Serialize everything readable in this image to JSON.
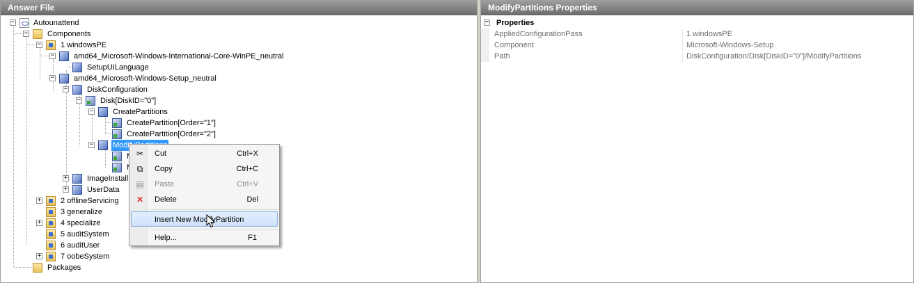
{
  "left_pane": {
    "title": "Answer File"
  },
  "right_pane": {
    "title": "ModifyPartitions Properties"
  },
  "tree": {
    "root": "Autounattend",
    "components": "Components",
    "pass1": "1 windowsPE",
    "comp_intl": "amd64_Microsoft-Windows-International-Core-WinPE_neutral",
    "setup_ui_language": "SetupUILanguage",
    "comp_setup": "amd64_Microsoft-Windows-Setup_neutral",
    "disk_configuration": "DiskConfiguration",
    "disk": "Disk[DiskID=\"0\"]",
    "create_partitions": "CreatePartitions",
    "create_partition_1": "CreatePartition[Order=\"1\"]",
    "create_partition_2": "CreatePartition[Order=\"2\"]",
    "modify_partitions": "ModifyPartitions",
    "modify_child_1": "M",
    "modify_child_2": "M",
    "image_install": "ImageInstall",
    "user_data": "UserData",
    "pass2": "2 offlineServicing",
    "pass3": "3 generalize",
    "pass4": "4 specialize",
    "pass5": "5 auditSystem",
    "pass6": "6 auditUser",
    "pass7": "7 oobeSystem",
    "packages": "Packages"
  },
  "properties": {
    "section": "Properties",
    "rows": [
      {
        "key": "AppliedConfigurationPass",
        "value": "1 windowsPE"
      },
      {
        "key": "Component",
        "value": "Microsoft-Windows-Setup"
      },
      {
        "key": "Path",
        "value": "DiskConfiguration/Disk[DiskID=\"0\"]/ModifyPartitions"
      }
    ]
  },
  "context_menu": {
    "cut": {
      "label": "Cut",
      "shortcut": "Ctrl+X",
      "icon": "scissors-icon"
    },
    "copy": {
      "label": "Copy",
      "shortcut": "Ctrl+C",
      "icon": "copy-icon"
    },
    "paste": {
      "label": "Paste",
      "shortcut": "Ctrl+V",
      "icon": "paste-icon",
      "disabled": true
    },
    "delete": {
      "label": "Delete",
      "shortcut": "Del",
      "icon": "delete-x-icon"
    },
    "insert": {
      "label": "Insert New ModifyPartition",
      "hovered": true
    },
    "help": {
      "label": "Help...",
      "shortcut": "F1"
    }
  },
  "colors": {
    "selection": "#3399ff",
    "header_bg": "#6e6e6e",
    "delete_icon": "#d83a2e"
  }
}
